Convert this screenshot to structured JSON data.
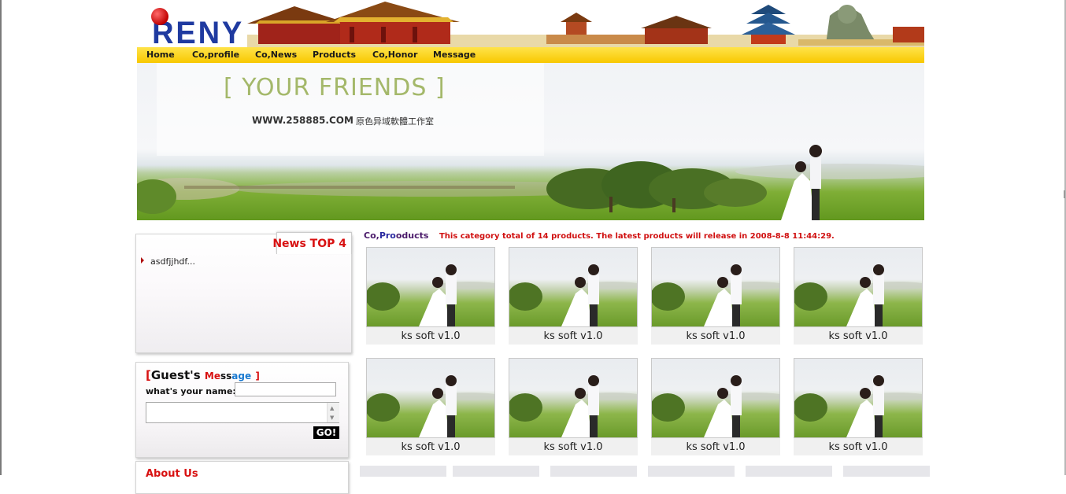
{
  "logo": {
    "text": "RENY"
  },
  "nav": [
    "Home",
    "Co,profile",
    "Co,News",
    "Products",
    "Co,Honor",
    "Message"
  ],
  "banner": {
    "slogan": "[ YOUR FRIENDS ]",
    "site": "WWW.258885.COM",
    "studio": "原色异域軟體工作室"
  },
  "news": {
    "title": "News TOP 4",
    "items": [
      "asdfjjhdf..."
    ]
  },
  "guestbook": {
    "title_open": "[",
    "title_word": "Guest's",
    "title_msg": [
      "M",
      "e",
      "s",
      "s",
      "a",
      "g",
      "e"
    ],
    "title_close": "]",
    "name_label": "what's your name:",
    "name_value": "",
    "message_value": "",
    "submit_label": "GO!",
    "scroll_up": "▲",
    "scroll_down": "▼"
  },
  "about": {
    "title": "About Us"
  },
  "products": {
    "heading_prefix": "Co,",
    "heading_mid": "Pro",
    "heading_suffix": "oducts",
    "note": "This category total of 14 products. The latest products will release in 2008-8-8 11:44:29.",
    "items": [
      {
        "caption": "ks soft v1.0"
      },
      {
        "caption": "ks soft v1.0"
      },
      {
        "caption": "ks soft v1.0"
      },
      {
        "caption": "ks soft v1.0"
      },
      {
        "caption": "ks soft v1.0"
      },
      {
        "caption": "ks soft v1.0"
      },
      {
        "caption": "ks soft v1.0"
      },
      {
        "caption": "ks soft v1.0"
      }
    ]
  },
  "colors": {
    "nav_bar": "#f8c800",
    "accent_red": "#d81111",
    "logo_blue": "#1f3aa0"
  }
}
